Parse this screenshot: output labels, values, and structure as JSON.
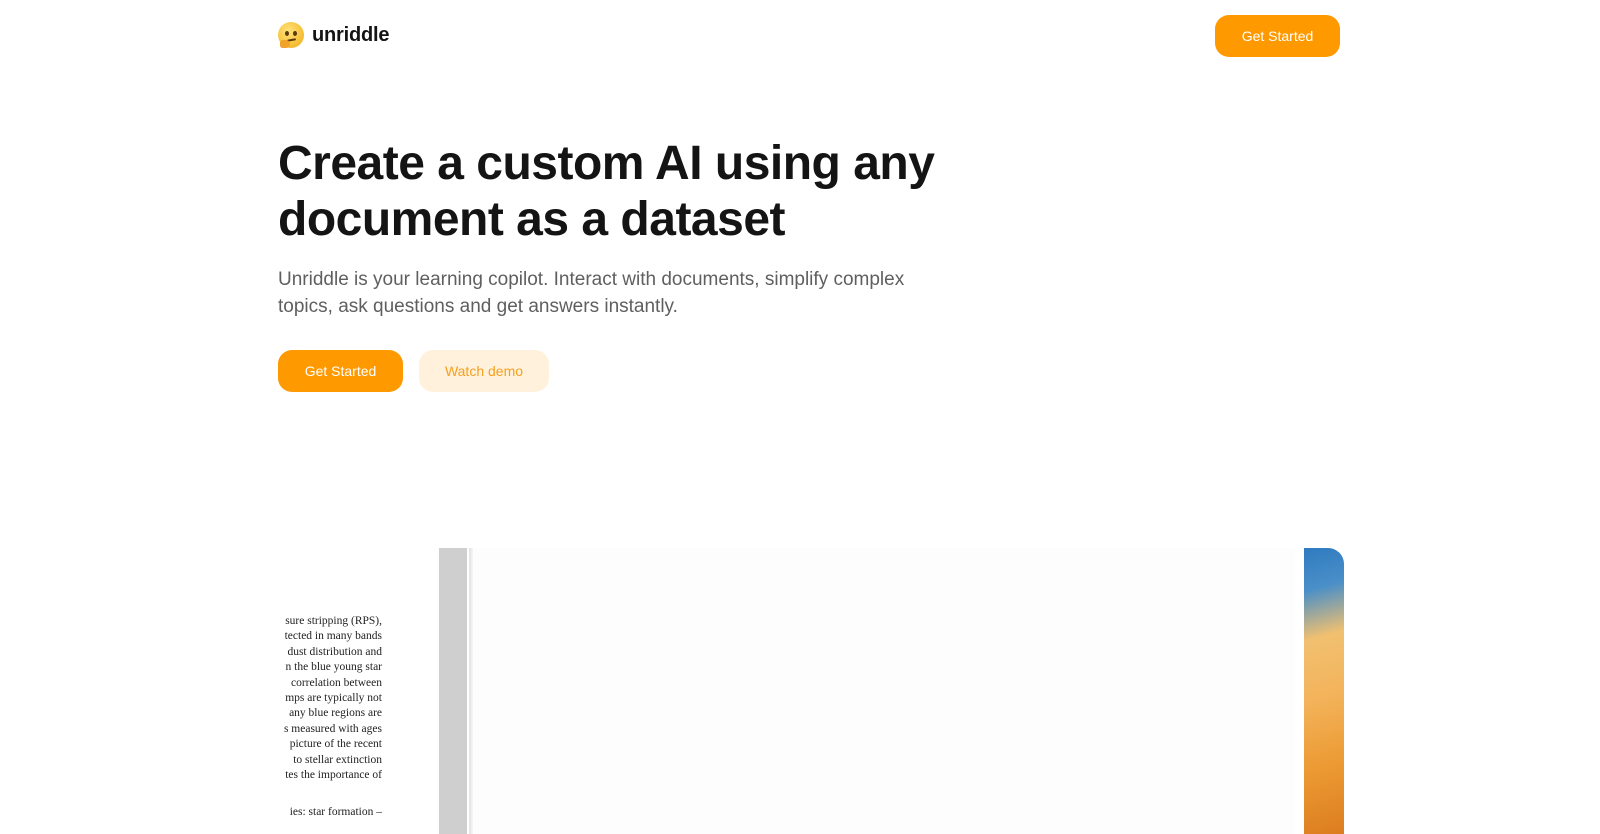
{
  "header": {
    "brand_name": "unriddle",
    "brand_icon": "thinking-face-emoji",
    "cta_label": "Get Started"
  },
  "hero": {
    "title": "Create a custom AI using any document as a dataset",
    "subtitle": "Unriddle is your learning copilot. Interact with documents, simplify complex topics, ask questions and get answers instantly.",
    "primary_label": "Get Started",
    "secondary_label": "Watch demo"
  },
  "preview": {
    "document_lines": [
      "sure stripping (RPS),",
      "tected in many bands",
      "dust distribution and",
      "n the blue young star",
      "correlation between",
      "mps are typically not",
      "any blue regions are",
      "s measured with ages",
      "picture of the recent",
      "to stellar extinction",
      "tes the importance of"
    ],
    "document_footer_line": "ies: star formation –"
  },
  "colors": {
    "accent": "#ff9900",
    "accent_soft": "#fff1dc",
    "text": "#141414",
    "muted_text": "#5f5f5f"
  }
}
